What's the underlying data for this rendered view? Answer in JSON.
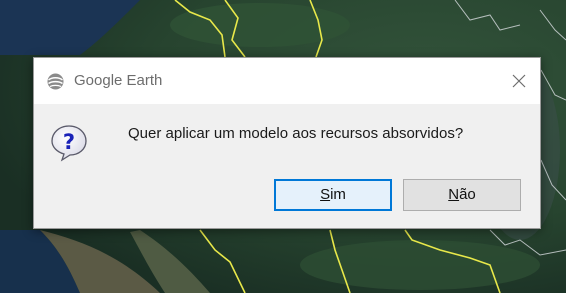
{
  "window": {
    "title": "Google Earth",
    "icon": "google-earth-icon",
    "close_icon": "close-icon"
  },
  "dialog": {
    "icon": "question-mark-icon",
    "message": "Quer aplicar um modelo aos recursos absorvidos?"
  },
  "buttons": {
    "yes": {
      "mnemonic": "S",
      "rest": "im",
      "is_default": true
    },
    "no": {
      "mnemonic": "N",
      "rest": "ão",
      "is_default": false
    }
  },
  "colors": {
    "default_button_border": "#0078d7",
    "border_line": "#e8e84a",
    "background_map": "#2a4a3a"
  }
}
